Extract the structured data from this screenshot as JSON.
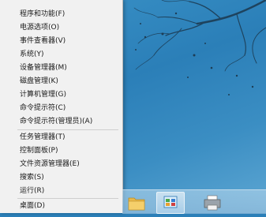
{
  "context_menu": {
    "items": [
      {
        "label": "程序和功能(F)"
      },
      {
        "label": "电源选项(O)"
      },
      {
        "label": "事件查看器(V)"
      },
      {
        "label": "系统(Y)"
      },
      {
        "label": "设备管理器(M)"
      },
      {
        "label": "磁盘管理(K)"
      },
      {
        "label": "计算机管理(G)"
      },
      {
        "label": "命令提示符(C)"
      },
      {
        "label": "命令提示符(管理员)(A)"
      },
      {
        "label": "任务管理器(T)"
      },
      {
        "label": "控制面板(P)"
      },
      {
        "label": "文件资源管理器(E)"
      },
      {
        "label": "搜索(S)"
      },
      {
        "label": "运行(R)"
      },
      {
        "label": "桌面(D)"
      }
    ]
  },
  "taskbar": {
    "buttons": [
      {
        "icon": "folder-icon"
      },
      {
        "icon": "control-panel-icon"
      },
      {
        "icon": "printer-icon"
      }
    ]
  },
  "colors": {
    "menu_bg": "#f1f1f1",
    "desktop_bg": "#2b7fb8"
  }
}
